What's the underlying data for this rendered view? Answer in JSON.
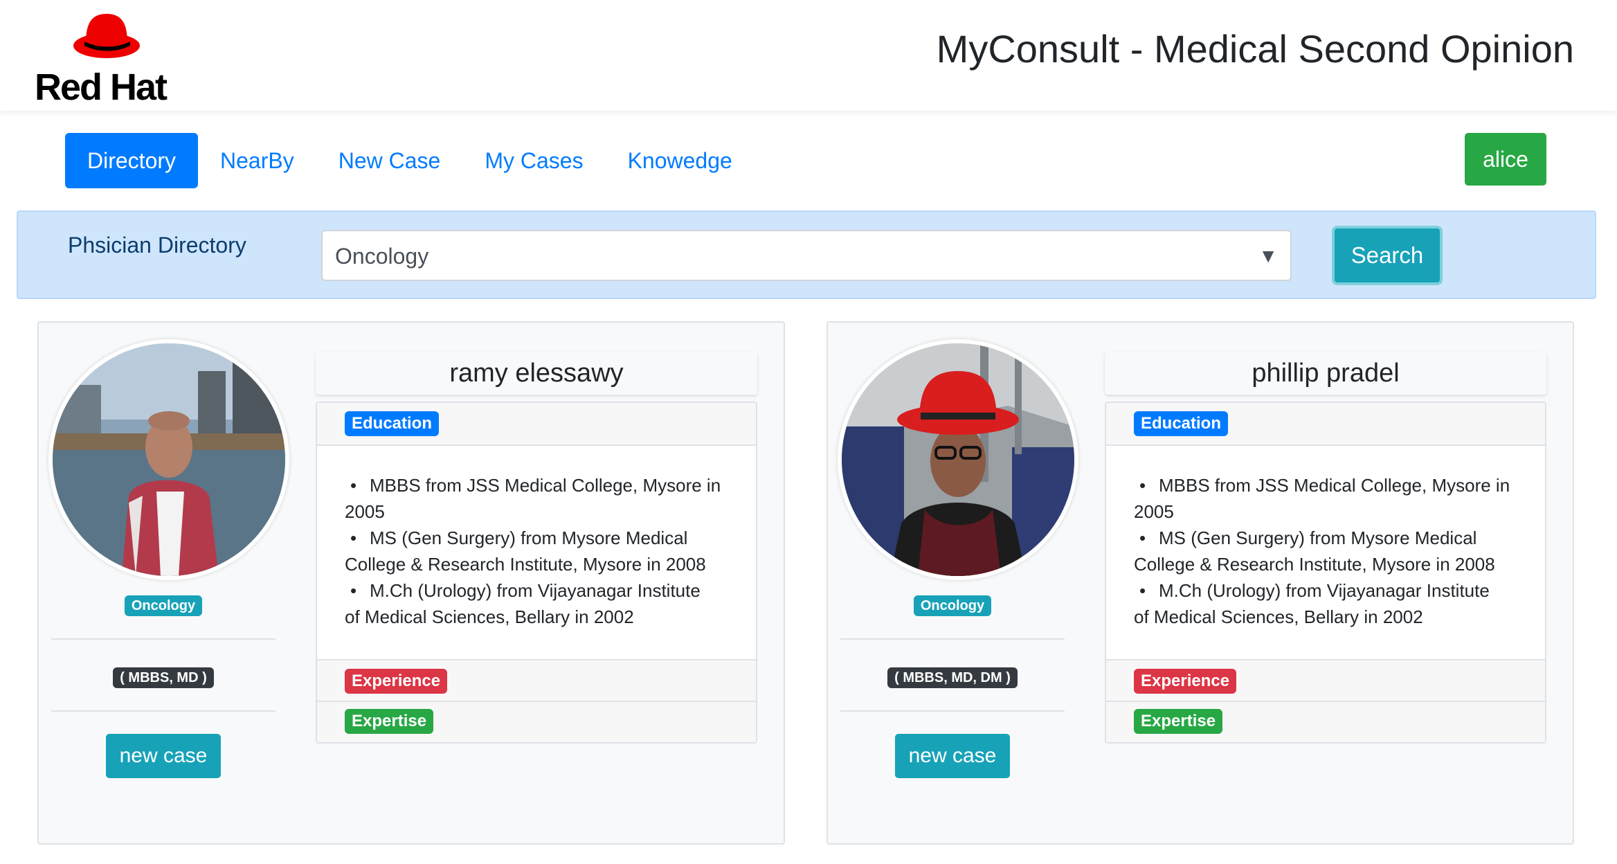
{
  "header": {
    "logo_text": "Red Hat",
    "app_title": "MyConsult - Medical Second Opinion"
  },
  "nav": {
    "items": [
      {
        "label": "Directory",
        "active": true
      },
      {
        "label": "NearBy",
        "active": false
      },
      {
        "label": "New Case",
        "active": false
      },
      {
        "label": "My Cases",
        "active": false
      },
      {
        "label": "Knowedge",
        "active": false
      }
    ],
    "user": "alice"
  },
  "search": {
    "label": "Phsician Directory",
    "selected": "Oncology",
    "caret": "▼",
    "button": "Search"
  },
  "physicians": [
    {
      "name": "ramy elessawy",
      "specialty": "Oncology",
      "degrees": "( MBBS, MD )",
      "action": "new case",
      "sections": {
        "education": "Education",
        "experience": "Experience",
        "expertise": "Expertise"
      },
      "education": [
        "MBBS from JSS Medical College, Mysore in",
        "2005",
        "MS (Gen Surgery) from Mysore Medical",
        "College & Research Institute, Mysore in 2008",
        "M.Ch (Urology) from Vijayanagar Institute",
        "of Medical Sciences, Bellary in 2002"
      ]
    },
    {
      "name": "phillip pradel",
      "specialty": "Oncology",
      "degrees": "( MBBS, MD, DM )",
      "action": "new case",
      "sections": {
        "education": "Education",
        "experience": "Experience",
        "expertise": "Expertise"
      },
      "education": [
        "MBBS from JSS Medical College, Mysore in",
        "2005",
        "MS (Gen Surgery) from Mysore Medical",
        "College & Research Institute, Mysore in 2008",
        "M.Ch (Urology) from Vijayanagar Institute",
        "of Medical Sciences, Bellary in 2002"
      ]
    }
  ],
  "colors": {
    "primary": "#007bff",
    "success": "#28a745",
    "info": "#17a2b8",
    "danger": "#dc3545",
    "dark": "#343a40",
    "brand_red": "#ee0000"
  }
}
